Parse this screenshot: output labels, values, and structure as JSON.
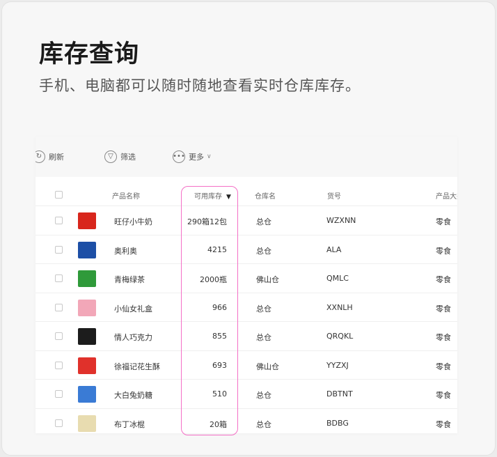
{
  "heading": "库存查询",
  "subheading": "手机、电脑都可以随时随地查看实时仓库库存。",
  "toolbar": {
    "refresh": "刷新",
    "filter": "筛选",
    "more": "更多"
  },
  "columns": {
    "product_name": "产品名称",
    "available_stock": "可用库存",
    "warehouse": "仓库名",
    "sku": "货号",
    "category": "产品大类"
  },
  "rows": [
    {
      "name": "旺仔小牛奶",
      "stock": "290箱12包",
      "warehouse": "总仓",
      "sku": "WZXNN",
      "category": "零食",
      "thumb_color": "#d8261c"
    },
    {
      "name": "奥利奥",
      "stock": "4215",
      "warehouse": "总仓",
      "sku": "ALA",
      "category": "零食",
      "thumb_color": "#1d4fa6"
    },
    {
      "name": "青梅绿茶",
      "stock": "2000瓶",
      "warehouse": "佛山仓",
      "sku": "QMLC",
      "category": "零食",
      "thumb_color": "#2f9a3a"
    },
    {
      "name": "小仙女礼盒",
      "stock": "966",
      "warehouse": "总仓",
      "sku": "XXNLH",
      "category": "零食",
      "thumb_color": "#f2a7b8"
    },
    {
      "name": "情人巧克力",
      "stock": "855",
      "warehouse": "总仓",
      "sku": "QRQKL",
      "category": "零食",
      "thumb_color": "#1c1c1c"
    },
    {
      "name": "徐福记花生酥",
      "stock": "693",
      "warehouse": "佛山仓",
      "sku": "YYZXJ",
      "category": "零食",
      "thumb_color": "#e0312b"
    },
    {
      "name": "大白兔奶糖",
      "stock": "510",
      "warehouse": "总仓",
      "sku": "DBTNT",
      "category": "零食",
      "thumb_color": "#3a7bd5"
    },
    {
      "name": "布丁冰棍",
      "stock": "20箱",
      "warehouse": "总仓",
      "sku": "BDBG",
      "category": "零食",
      "thumb_color": "#e8dcb0"
    }
  ],
  "colors": {
    "highlight": "#f46fc6",
    "background": "#f7f7f7"
  }
}
